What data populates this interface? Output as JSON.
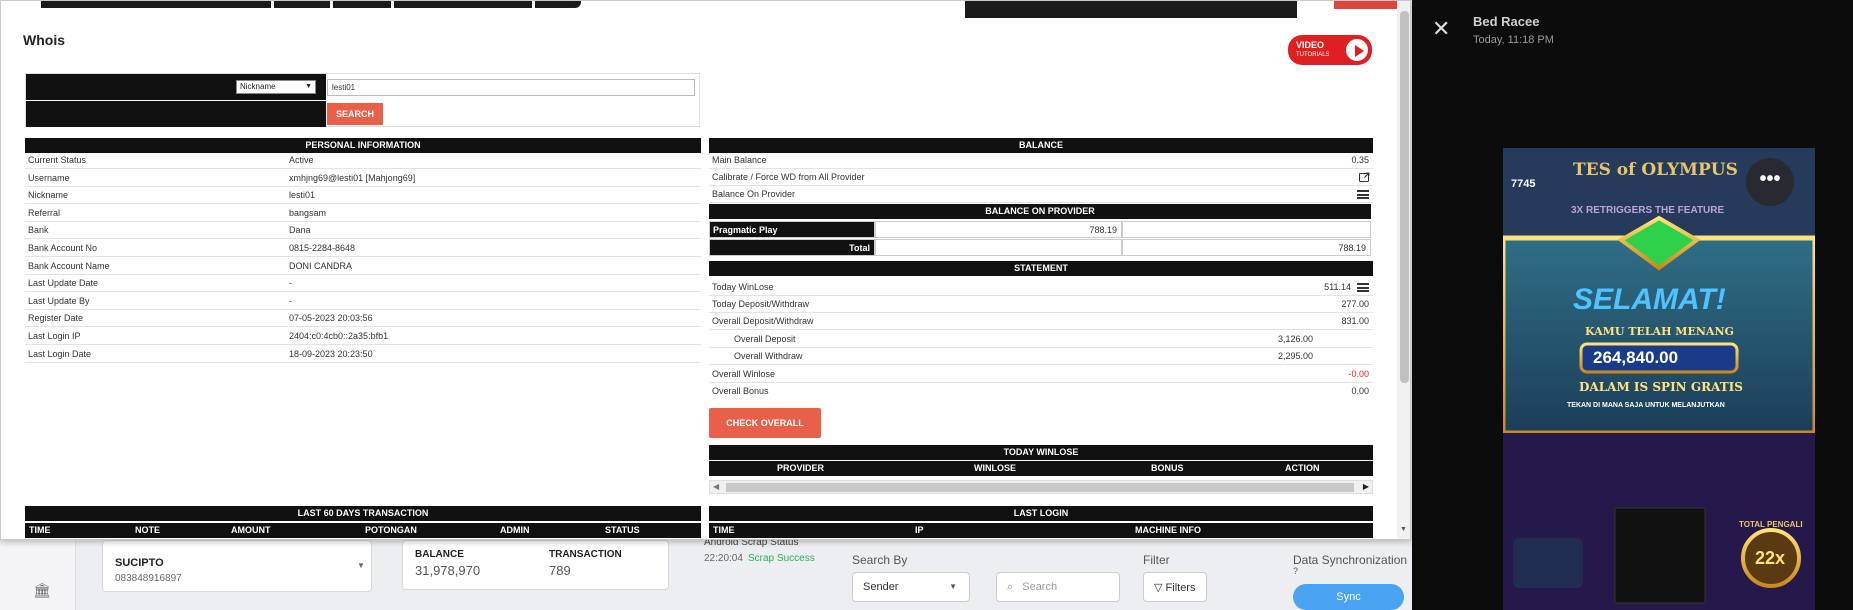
{
  "background": {
    "user": {
      "name": "SUCIPTO",
      "phone": "083848916897"
    },
    "balance": {
      "label": "BALANCE",
      "value": "31,978,970"
    },
    "transaction": {
      "label": "TRANSACTION",
      "value": "789"
    },
    "scrap_status": {
      "label": "Android Scrap Status",
      "time": "22:20:04",
      "status": "Scrap Success"
    },
    "search_by": {
      "label": "Search By",
      "value": "Sender"
    },
    "search": {
      "placeholder": "Search"
    },
    "filter": {
      "label": "Filter",
      "button": "Filters"
    },
    "data_sync": {
      "label": "Data Synchronization",
      "help": "?",
      "button": "Sync"
    }
  },
  "modal": {
    "title": "Whois",
    "video_badge": {
      "line1": "VIDEO",
      "line2": "TUTORIALS"
    },
    "search": {
      "select_value": "Nickname",
      "input_value": "lesti01",
      "button": "SEARCH"
    },
    "personal": {
      "header": "PERSONAL INFORMATION",
      "rows": [
        {
          "k": "Current Status",
          "v": "Active"
        },
        {
          "k": "Username",
          "v": "xmhjng69@lesti01  [Mahjong69]"
        },
        {
          "k": "Nickname",
          "v": "lesti01"
        },
        {
          "k": "Referral",
          "v": "bangsam"
        },
        {
          "k": "Bank",
          "v": "Dana"
        },
        {
          "k": "Bank Account No",
          "v": "0815-2284-8648"
        },
        {
          "k": "Bank Account Name",
          "v": "DONI CANDRA"
        },
        {
          "k": "Last Update Date",
          "v": "-"
        },
        {
          "k": "Last Update By",
          "v": "-"
        },
        {
          "k": "Register Date",
          "v": "07-05-2023 20:03:56"
        },
        {
          "k": "Last Login IP",
          "v": "2404:c0:4cb0::2a35:bfb1"
        },
        {
          "k": "Last Login Date",
          "v": "18-09-2023 20:23:50"
        }
      ]
    },
    "balance": {
      "header": "BALANCE",
      "main_balance": {
        "k": "Main Balance",
        "v": "0.35"
      },
      "calibrate": {
        "k": "Calibrate / Force WD from All Provider"
      },
      "on_provider": {
        "k": "Balance On Provider"
      },
      "provider_header": "BALANCE ON PROVIDER",
      "provider_row": {
        "name": "Pragmatic Play",
        "value": "788.19"
      },
      "total_row": {
        "label": "Total",
        "value": "788.19"
      }
    },
    "statement": {
      "header": "STATEMENT",
      "today_winlose": {
        "k": "Today WinLose",
        "v": "511.14"
      },
      "today_dw": {
        "k": "Today Deposit/Withdraw",
        "v": "277.00"
      },
      "overall_dw": {
        "k": "Overall Deposit/Withdraw",
        "v": "831.00"
      },
      "overall_deposit": {
        "k": "Overall Deposit",
        "v": "3,126.00"
      },
      "overall_withdraw": {
        "k": "Overall Withdraw",
        "v": "2,295.00"
      },
      "overall_winlose": {
        "k": "Overall Winlose",
        "v": "-0.00"
      },
      "overall_bonus": {
        "k": "Overall Bonus",
        "v": "0.00"
      },
      "check_button": "CHECK OVERALL"
    },
    "today_winlose_table": {
      "header": "TODAY WINLOSE",
      "columns": [
        "PROVIDER",
        "WINLOSE",
        "BONUS",
        "ACTION"
      ]
    },
    "last60": {
      "header": "LAST 60 DAYS TRANSACTION",
      "columns": [
        "TIME",
        "NOTE",
        "AMOUNT",
        "POTONGAN",
        "ADMIN",
        "STATUS"
      ]
    },
    "last_login": {
      "header": "LAST LOGIN",
      "columns": [
        "TIME",
        "IP",
        "MACHINE INFO"
      ]
    }
  },
  "viewer": {
    "close": "✕",
    "title": "Bed Racee",
    "time": "Today, 11:18 PM",
    "game": {
      "count": "7745",
      "game_title": "TES of OLYMPUS",
      "retrigger": "3X RETRIGGERS THE FEATURE",
      "congrats": "SELAMAT!",
      "won": "KAMU TELAH MENANG",
      "amount": "264,840.00",
      "free_spin": "DALAM IS SPIN GRATIS",
      "tap": "TEKAN DI MANA SAJA UNTUK MELANJUTKAN",
      "total_label": "TOTAL PENGALI",
      "multiplier": "22x",
      "more": "•••"
    }
  },
  "colors": {
    "accent": "#e8604a",
    "dark": "#111111",
    "sync": "#4aa3f2",
    "success": "#2fae58",
    "negative": "#e02020"
  }
}
